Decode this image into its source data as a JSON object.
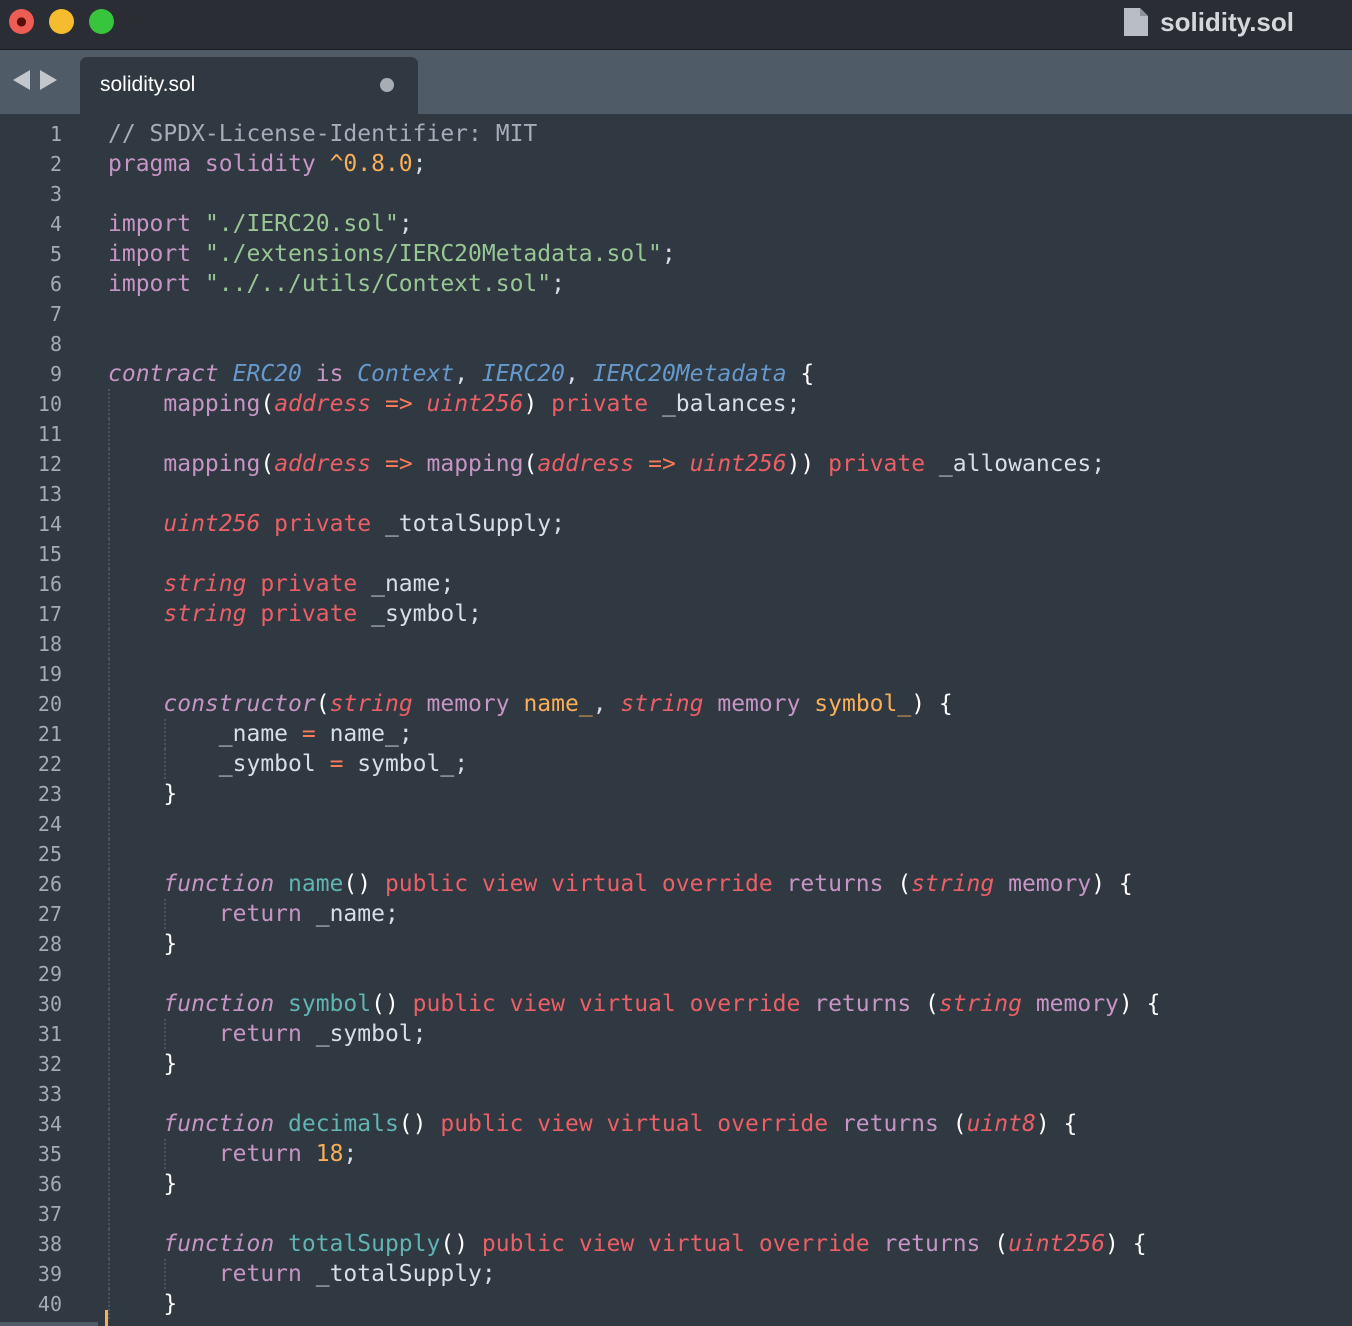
{
  "window": {
    "title": "solidity.sol",
    "controls": {
      "close": "×",
      "minimize": "−",
      "maximize": "+"
    }
  },
  "tabs": [
    {
      "label": "solidity.sol",
      "dirty": true,
      "active": true
    }
  ],
  "editor": {
    "language": "Solidity",
    "colors": {
      "background": "#303841",
      "comment": "#a6acb9",
      "keyword": "#c695c6",
      "string": "#99c794",
      "number": "#f9ae58",
      "type": "#ec5f66",
      "function": "#5fb4b4",
      "class": "#6699cc",
      "parameter": "#f9ae58"
    },
    "lines": [
      {
        "n": "1",
        "g": 0,
        "t": [
          [
            "c",
            "// SPDX-License-Identifier: MIT"
          ]
        ]
      },
      {
        "n": "2",
        "g": 0,
        "t": [
          [
            "k",
            "pragma solidity "
          ],
          [
            "n",
            "^0.8.0"
          ],
          [
            "pl",
            ";"
          ]
        ]
      },
      {
        "n": "3",
        "g": 0,
        "t": []
      },
      {
        "n": "4",
        "g": 0,
        "t": [
          [
            "k",
            "import "
          ],
          [
            "s",
            "\"./IERC20.sol\""
          ],
          [
            "pl",
            ";"
          ]
        ]
      },
      {
        "n": "5",
        "g": 0,
        "t": [
          [
            "k",
            "import "
          ],
          [
            "s",
            "\"./extensions/IERC20Metadata.sol\""
          ],
          [
            "pl",
            ";"
          ]
        ]
      },
      {
        "n": "6",
        "g": 0,
        "t": [
          [
            "k",
            "import "
          ],
          [
            "s",
            "\"../../utils/Context.sol\""
          ],
          [
            "pl",
            ";"
          ]
        ]
      },
      {
        "n": "7",
        "g": 0,
        "t": []
      },
      {
        "n": "8",
        "g": 0,
        "t": []
      },
      {
        "n": "9",
        "g": 0,
        "t": [
          [
            "st",
            "contract "
          ],
          [
            "cl",
            "ERC20"
          ],
          [
            "kw",
            " is "
          ],
          [
            "cl",
            "Context"
          ],
          [
            "pl",
            ", "
          ],
          [
            "cl",
            "IERC20"
          ],
          [
            "pl",
            ", "
          ],
          [
            "cl",
            "IERC20Metadata"
          ],
          [
            "br",
            " {"
          ]
        ]
      },
      {
        "n": "10",
        "g": 1,
        "t": [
          [
            "pl",
            "    "
          ],
          [
            "k",
            "mapping"
          ],
          [
            "br",
            "("
          ],
          [
            "ty",
            "address"
          ],
          [
            "o",
            " => "
          ],
          [
            "ty",
            "uint256"
          ],
          [
            "br",
            ")"
          ],
          [
            "m",
            " private "
          ],
          [
            "pl",
            "_balances;"
          ]
        ]
      },
      {
        "n": "11",
        "g": 1,
        "t": []
      },
      {
        "n": "12",
        "g": 1,
        "t": [
          [
            "pl",
            "    "
          ],
          [
            "k",
            "mapping"
          ],
          [
            "br",
            "("
          ],
          [
            "ty",
            "address"
          ],
          [
            "o",
            " => "
          ],
          [
            "k",
            "mapping"
          ],
          [
            "br",
            "("
          ],
          [
            "ty",
            "address"
          ],
          [
            "o",
            " => "
          ],
          [
            "ty",
            "uint256"
          ],
          [
            "br",
            "))"
          ],
          [
            "m",
            " private "
          ],
          [
            "pl",
            "_allowances;"
          ]
        ]
      },
      {
        "n": "13",
        "g": 1,
        "t": []
      },
      {
        "n": "14",
        "g": 1,
        "t": [
          [
            "pl",
            "    "
          ],
          [
            "ty",
            "uint256"
          ],
          [
            "m",
            " private "
          ],
          [
            "pl",
            "_totalSupply;"
          ]
        ]
      },
      {
        "n": "15",
        "g": 1,
        "t": []
      },
      {
        "n": "16",
        "g": 1,
        "t": [
          [
            "pl",
            "    "
          ],
          [
            "ty",
            "string"
          ],
          [
            "m",
            " private "
          ],
          [
            "pl",
            "_name;"
          ]
        ]
      },
      {
        "n": "17",
        "g": 1,
        "t": [
          [
            "pl",
            "    "
          ],
          [
            "ty",
            "string"
          ],
          [
            "m",
            " private "
          ],
          [
            "pl",
            "_symbol;"
          ]
        ]
      },
      {
        "n": "18",
        "g": 1,
        "t": []
      },
      {
        "n": "19",
        "g": 1,
        "t": []
      },
      {
        "n": "20",
        "g": 1,
        "t": [
          [
            "pl",
            "    "
          ],
          [
            "st",
            "constructor"
          ],
          [
            "br",
            "("
          ],
          [
            "ty",
            "string"
          ],
          [
            "k",
            " memory "
          ],
          [
            "p",
            "name_"
          ],
          [
            "pl",
            ", "
          ],
          [
            "ty",
            "string"
          ],
          [
            "k",
            " memory "
          ],
          [
            "p",
            "symbol_"
          ],
          [
            "br",
            ") {"
          ]
        ]
      },
      {
        "n": "21",
        "g": 2,
        "t": [
          [
            "pl",
            "        _name "
          ],
          [
            "o",
            "="
          ],
          [
            "pl",
            " name_;"
          ]
        ]
      },
      {
        "n": "22",
        "g": 2,
        "t": [
          [
            "pl",
            "        _symbol "
          ],
          [
            "o",
            "="
          ],
          [
            "pl",
            " symbol_;"
          ]
        ]
      },
      {
        "n": "23",
        "g": 1,
        "t": [
          [
            "pl",
            "    "
          ],
          [
            "br",
            "}"
          ]
        ]
      },
      {
        "n": "24",
        "g": 1,
        "t": []
      },
      {
        "n": "25",
        "g": 1,
        "t": []
      },
      {
        "n": "26",
        "g": 1,
        "t": [
          [
            "pl",
            "    "
          ],
          [
            "st",
            "function "
          ],
          [
            "f",
            "name"
          ],
          [
            "br",
            "()"
          ],
          [
            "m",
            " public view virtual override "
          ],
          [
            "k",
            "returns "
          ],
          [
            "br",
            "("
          ],
          [
            "ty",
            "string"
          ],
          [
            "k",
            " memory"
          ],
          [
            "br",
            ") {"
          ]
        ]
      },
      {
        "n": "27",
        "g": 2,
        "t": [
          [
            "pl",
            "        "
          ],
          [
            "k",
            "return "
          ],
          [
            "pl",
            "_name;"
          ]
        ]
      },
      {
        "n": "28",
        "g": 1,
        "t": [
          [
            "pl",
            "    "
          ],
          [
            "br",
            "}"
          ]
        ]
      },
      {
        "n": "29",
        "g": 1,
        "t": []
      },
      {
        "n": "30",
        "g": 1,
        "t": [
          [
            "pl",
            "    "
          ],
          [
            "st",
            "function "
          ],
          [
            "f",
            "symbol"
          ],
          [
            "br",
            "()"
          ],
          [
            "m",
            " public view virtual override "
          ],
          [
            "k",
            "returns "
          ],
          [
            "br",
            "("
          ],
          [
            "ty",
            "string"
          ],
          [
            "k",
            " memory"
          ],
          [
            "br",
            ") {"
          ]
        ]
      },
      {
        "n": "31",
        "g": 2,
        "t": [
          [
            "pl",
            "        "
          ],
          [
            "k",
            "return "
          ],
          [
            "pl",
            "_symbol;"
          ]
        ]
      },
      {
        "n": "32",
        "g": 1,
        "t": [
          [
            "pl",
            "    "
          ],
          [
            "br",
            "}"
          ]
        ]
      },
      {
        "n": "33",
        "g": 1,
        "t": []
      },
      {
        "n": "34",
        "g": 1,
        "t": [
          [
            "pl",
            "    "
          ],
          [
            "st",
            "function "
          ],
          [
            "f",
            "decimals"
          ],
          [
            "br",
            "()"
          ],
          [
            "m",
            " public view virtual override "
          ],
          [
            "k",
            "returns "
          ],
          [
            "br",
            "("
          ],
          [
            "ty",
            "uint8"
          ],
          [
            "br",
            ") {"
          ]
        ]
      },
      {
        "n": "35",
        "g": 2,
        "t": [
          [
            "pl",
            "        "
          ],
          [
            "k",
            "return "
          ],
          [
            "n",
            "18"
          ],
          [
            "pl",
            ";"
          ]
        ]
      },
      {
        "n": "36",
        "g": 1,
        "t": [
          [
            "pl",
            "    "
          ],
          [
            "br",
            "}"
          ]
        ]
      },
      {
        "n": "37",
        "g": 1,
        "t": []
      },
      {
        "n": "38",
        "g": 1,
        "t": [
          [
            "pl",
            "    "
          ],
          [
            "st",
            "function "
          ],
          [
            "f",
            "totalSupply"
          ],
          [
            "br",
            "()"
          ],
          [
            "m",
            " public view virtual override "
          ],
          [
            "k",
            "returns "
          ],
          [
            "br",
            "("
          ],
          [
            "ty",
            "uint256"
          ],
          [
            "br",
            ") {"
          ]
        ]
      },
      {
        "n": "39",
        "g": 2,
        "t": [
          [
            "pl",
            "        "
          ],
          [
            "k",
            "return "
          ],
          [
            "pl",
            "_totalSupply;"
          ]
        ]
      },
      {
        "n": "40",
        "g": 1,
        "t": [
          [
            "pl",
            "    "
          ],
          [
            "br",
            "}"
          ]
        ]
      }
    ]
  }
}
